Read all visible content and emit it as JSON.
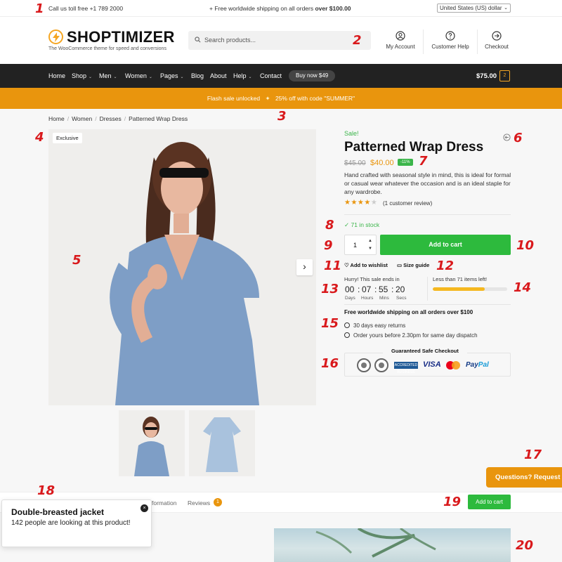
{
  "topbar": {
    "phone": "Call us toll free +1 789 2000",
    "shipping_prefix": "+ Free worldwide shipping on all orders ",
    "shipping_bold": "over $100.00",
    "region": "United States (US) dollar"
  },
  "header": {
    "logo": "SHOPTIMIZER",
    "tagline": "The WooCommerce theme for speed and conversions",
    "search_placeholder": "Search products...",
    "links": [
      "My Account",
      "Customer Help",
      "Checkout"
    ]
  },
  "nav": {
    "items": [
      "Home",
      "Shop",
      "Men",
      "Women",
      "Pages",
      "Blog",
      "About",
      "Help",
      "Contact"
    ],
    "buy_button": "Buy now $49",
    "cart_total": "$75.00",
    "cart_count": "2"
  },
  "flash": {
    "left": "Flash sale unlocked",
    "right": "25% off with code \"SUMMER\""
  },
  "breadcrumb": [
    "Home",
    "Women",
    "Dresses",
    "Patterned Wrap Dress"
  ],
  "gallery": {
    "badge": "Exclusive",
    "thumbnails": 2
  },
  "product": {
    "sale_label": "Sale!",
    "title": "Patterned Wrap Dress",
    "old_price": "$45.00",
    "new_price": "$40.00",
    "discount": "-11%",
    "description": "Hand crafted with seasonal style in mind, this is ideal for formal or casual wear whatever the occasion and is an ideal staple for any wardrobe.",
    "rating": 4,
    "rating_max": 5,
    "reviews": "(1 customer review)",
    "stock": "71 in stock",
    "quantity": "1",
    "add_to_cart": "Add to cart",
    "wishlist": "Add to wishlist",
    "size_guide": "Size guide",
    "countdown": {
      "heading": "Hurry! This sale ends in",
      "days": "00",
      "hours": "07",
      "mins": "55",
      "secs": "20",
      "labels": [
        "Days",
        "Hours",
        "Mins",
        "Secs"
      ]
    },
    "stock_bar": {
      "label": "Less than 71 items left!",
      "fill_fraction": 0.7
    },
    "free_shipping": "Free worldwide shipping on all orders over $100",
    "perks": [
      "30 days easy returns",
      "Order yours before 2.30pm for same day dispatch"
    ],
    "safe_checkout": "Guaranteed Safe Checkout",
    "payment": {
      "visa": "VISA",
      "paypal_1": "Pay",
      "paypal_2": "Pal",
      "bbb": "ACCREDITED BUSINESS"
    }
  },
  "bottom": {
    "tab_partial": "formation",
    "tab_reviews": "Reviews",
    "reviews_count": "1",
    "sticky_add_to_cart": "Add to cart",
    "questions": "Questions? Request",
    "popup": {
      "title": "Double-breasted jacket",
      "text": "142 people are looking at this product!",
      "close": "×"
    }
  },
  "annotations": [
    "1",
    "2",
    "3",
    "4",
    "5",
    "6",
    "7",
    "8",
    "9",
    "10",
    "11",
    "12",
    "13",
    "14",
    "15",
    "16",
    "17",
    "18",
    "19",
    "20"
  ],
  "colors": {
    "accent": "#e9950d",
    "green": "#2dba3d",
    "nav_bg": "#222222",
    "annotation": "#d9191c"
  }
}
